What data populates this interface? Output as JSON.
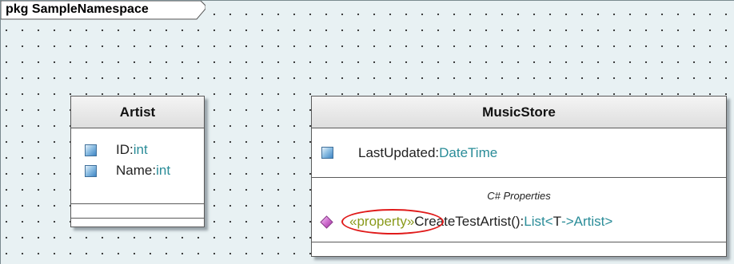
{
  "package": {
    "label": "pkg SampleNamespace"
  },
  "artist": {
    "name": "Artist",
    "attributes": [
      {
        "name": "ID",
        "sep": ":",
        "type": "int"
      },
      {
        "name": "Name",
        "sep": ":",
        "type": "int"
      }
    ]
  },
  "musicstore": {
    "name": "MusicStore",
    "attribute": {
      "name": "LastUpdated",
      "sep": ":",
      "type": "DateTime"
    },
    "operation_group_label": "C# Properties",
    "operation": {
      "stereotype": "«property»",
      "name": "CreateTestArtist",
      "params": "()",
      "colon": ":",
      "return_type": "List",
      "template_open": "<",
      "template_param": "T",
      "template_arrow": "->",
      "template_arg": "Artist",
      "template_close": ">"
    }
  },
  "colors": {
    "canvas": "#e8f1f3",
    "type_text": "#2a8c98",
    "stereotype_text": "#8a9a1c",
    "highlight_ellipse": "#e01a1a",
    "operation_icon": "#d070d0"
  },
  "icons": {
    "attribute": "attribute-icon",
    "operation": "operation-diamond-icon"
  }
}
